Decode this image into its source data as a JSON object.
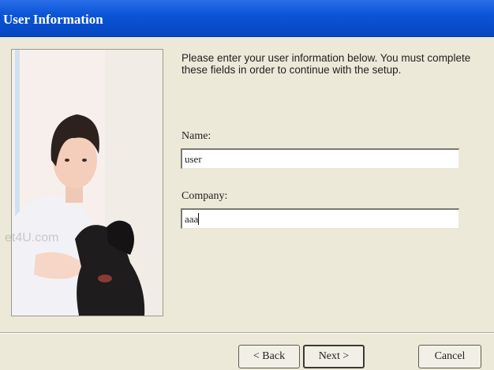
{
  "window": {
    "title": "User Information"
  },
  "main": {
    "instructions": "Please enter your user information below.  You must complete these fields in order to continue with the setup.",
    "name_label": "Name:",
    "name_value": "user",
    "company_label": "Company:",
    "company_value": "aaa"
  },
  "watermark": "et4U.com",
  "buttons": {
    "back": "< Back",
    "next": "Next >",
    "cancel": "Cancel"
  },
  "colors": {
    "titlebar": "#0b55d6",
    "dialog_bg": "#ece9d8"
  }
}
